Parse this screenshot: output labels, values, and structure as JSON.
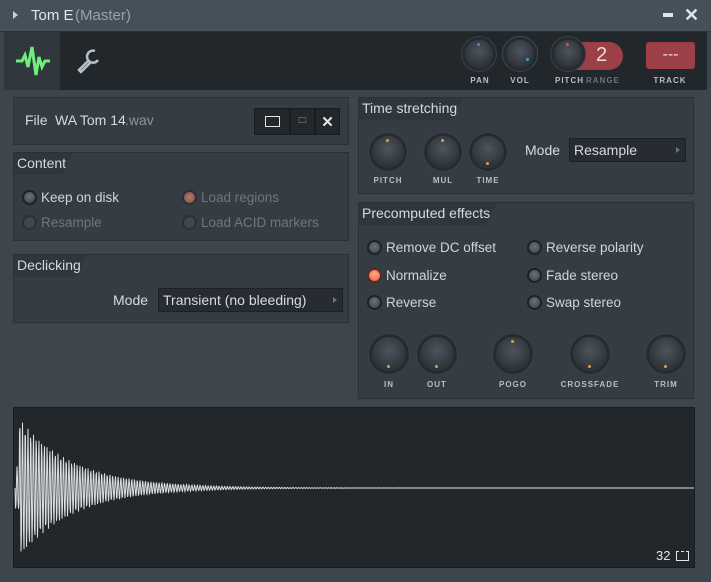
{
  "window": {
    "title": "Tom E",
    "subtitle": "(Master)"
  },
  "toolbar": {
    "pan_label": "PAN",
    "vol_label": "VOL",
    "pitch_label": "PITCH",
    "range_label": "RANGE",
    "range_value": "2",
    "track_label": "TRACK",
    "track_value": "---",
    "vol_level": 0.75
  },
  "file": {
    "label": "File",
    "name": "WA Tom 14",
    "ext": ".wav"
  },
  "content": {
    "title": "Content",
    "options": [
      {
        "label": "Keep on disk",
        "checked": false,
        "enabled": true
      },
      {
        "label": "Resample",
        "checked": false,
        "enabled": false
      },
      {
        "label": "Load regions",
        "checked": true,
        "enabled": false
      },
      {
        "label": "Load ACID markers",
        "checked": false,
        "enabled": false
      }
    ]
  },
  "declicking": {
    "title": "Declicking",
    "mode_label": "Mode",
    "mode_value": "Transient (no bleeding)"
  },
  "time_stretching": {
    "title": "Time stretching",
    "knobs": [
      "PITCH",
      "MUL",
      "TIME"
    ],
    "mode_label": "Mode",
    "mode_value": "Resample"
  },
  "precomputed": {
    "title": "Precomputed effects",
    "options": [
      {
        "label": "Remove DC offset",
        "checked": false
      },
      {
        "label": "Normalize",
        "checked": true
      },
      {
        "label": "Reverse",
        "checked": false
      },
      {
        "label": "Reverse polarity",
        "checked": false
      },
      {
        "label": "Fade stereo",
        "checked": false
      },
      {
        "label": "Swap stereo",
        "checked": false
      }
    ],
    "knobs": [
      "IN",
      "OUT",
      "POGO",
      "CROSSFADE",
      "TRIM"
    ]
  },
  "waveform": {
    "zoom_value": "32"
  }
}
